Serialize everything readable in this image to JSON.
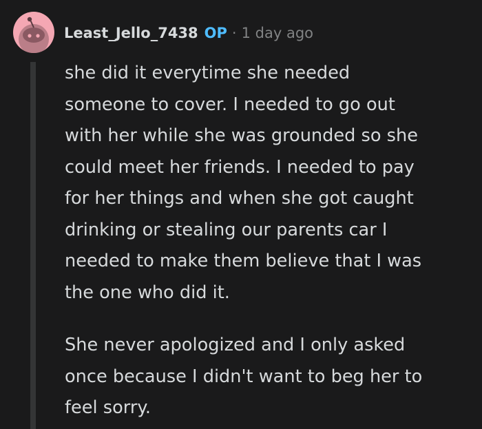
{
  "comment": {
    "author": "Least_Jello_7438",
    "op_label": "OP",
    "separator": "·",
    "timestamp": "1 day ago",
    "avatar_icon": "snoo-avatar-icon",
    "colors": {
      "background": "#1a1a1b",
      "text": "#d7dadc",
      "op": "#4fbcff",
      "muted": "#818384",
      "avatar_bg": "#f4a7b3",
      "thread_line": "#343536"
    },
    "paragraphs": [
      "she did it everytime she needed\nsomeone to cover. I needed to go out\nwith her while she was grounded so she\ncould meet her friends. I needed to pay\nfor her things and when she got caught\ndrinking or stealing our parents car I\nneeded to make them believe that I was\nthe one who did it.",
      "She never apologized and I only asked\nonce because I didn't want to beg her to\nfeel sorry."
    ]
  }
}
